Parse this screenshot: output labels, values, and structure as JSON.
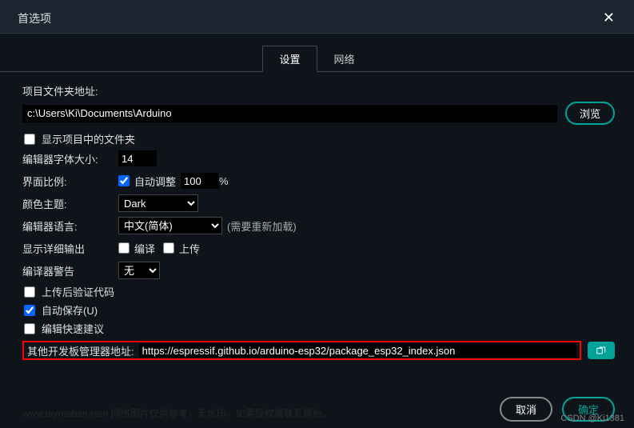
{
  "dialog": {
    "title": "首选项",
    "close": "✕"
  },
  "tabs": {
    "settings": "设置",
    "network": "网络"
  },
  "fields": {
    "sketchbook_label": "项目文件夹地址:",
    "sketchbook_path": "c:\\Users\\Ki\\Documents\\Arduino",
    "browse": "浏览",
    "show_files": "显示项目中的文件夹",
    "font_size_label": "编辑器字体大小:",
    "font_size_value": "14",
    "scale_label": "界面比例:",
    "scale_auto": "自动调整",
    "scale_value": "100",
    "scale_unit": "%",
    "theme_label": "颜色主题:",
    "theme_value": "Dark",
    "lang_label": "编辑器语言:",
    "lang_value": "中文(简体)",
    "lang_note": "(需要重新加载)",
    "verbose_label": "显示详细输出",
    "verbose_compile": "编译",
    "verbose_upload": "上传",
    "warnings_label": "编译器警告",
    "warnings_value": "无",
    "verify_after_upload": "上传后验证代码",
    "autosave": "自动保存(U)",
    "quick_suggest": "编辑快速建议",
    "boards_url_label": "其他开发板管理器地址:",
    "boards_url_value": "https://espressif.github.io/arduino-esp32/package_esp32_index.json"
  },
  "footer": {
    "cancel": "取消",
    "ok": "确定"
  },
  "watermark": "CSDN @Ki1381",
  "ghost": "www.taymoban.com 网络图片仅供参考，无水印，如需授权请联系原始。"
}
